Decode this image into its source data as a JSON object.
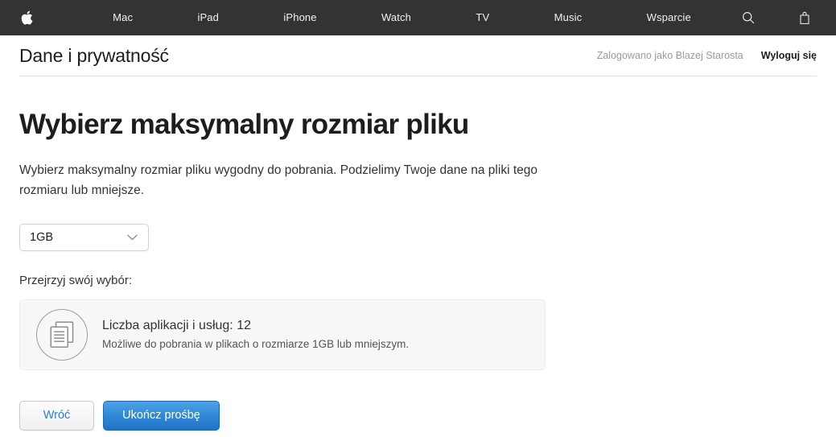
{
  "globalnav": {
    "apple_logo": "apple-logo",
    "items": [
      {
        "label": "Mac",
        "name": "nav-mac"
      },
      {
        "label": "iPad",
        "name": "nav-ipad"
      },
      {
        "label": "iPhone",
        "name": "nav-iphone"
      },
      {
        "label": "Watch",
        "name": "nav-watch"
      },
      {
        "label": "TV",
        "name": "nav-tv"
      },
      {
        "label": "Music",
        "name": "nav-music"
      },
      {
        "label": "Wsparcie",
        "name": "nav-wsparcie"
      }
    ],
    "search_icon": "search-icon",
    "bag_icon": "shopping-bag-icon",
    "background_color": "#333333"
  },
  "page_header": {
    "title": "Dane i prywatność",
    "signed_in_as": "Zalogowano jako Blazej Starosta",
    "sign_out_label": "Wyloguj się"
  },
  "main": {
    "heading": "Wybierz maksymalny rozmiar pliku",
    "intro": "Wybierz maksymalny rozmiar pliku wygodny do pobrania. Podzielimy Twoje dane na pliki tego rozmiaru lub mniejsze.",
    "file_size_select": {
      "selected": "1GB",
      "chevron_icon": "chevron-down-icon"
    },
    "review_label": "Przejrzyj swój wybór:",
    "summary_card": {
      "icon": "documents-icon",
      "title": "Liczba aplikacji i usług: 12",
      "subtitle": "Możliwe do pobrania w plikach o rozmiarze 1GB lub mniejszym."
    },
    "buttons": {
      "back_label": "Wróć",
      "submit_label": "Ukończ prośbę",
      "primary_color": "#2f88d6",
      "secondary_text_color": "#2b7fd4"
    }
  }
}
